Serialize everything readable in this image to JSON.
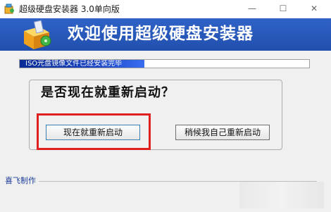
{
  "window": {
    "title": "超级硬盘安装器 3.0单向版",
    "min_glyph": "—",
    "max_glyph": "☐",
    "close_glyph": "✕"
  },
  "banner": {
    "title": "欢迎使用超级硬盘安装器",
    "icon": "installer-box-icon"
  },
  "progress": {
    "text": "ISO光盘镜像文件已经安装完毕",
    "fraction": 0.43
  },
  "dialog": {
    "question": "是否现在就重新启动？",
    "restart_now_label": "现在就重新启动",
    "restart_later_label": "稍候我自己重新启动"
  },
  "footer": {
    "credit": "喜飞制作"
  },
  "colors": {
    "banner_blue": "#2f63c6",
    "highlight_red": "#e02020"
  }
}
